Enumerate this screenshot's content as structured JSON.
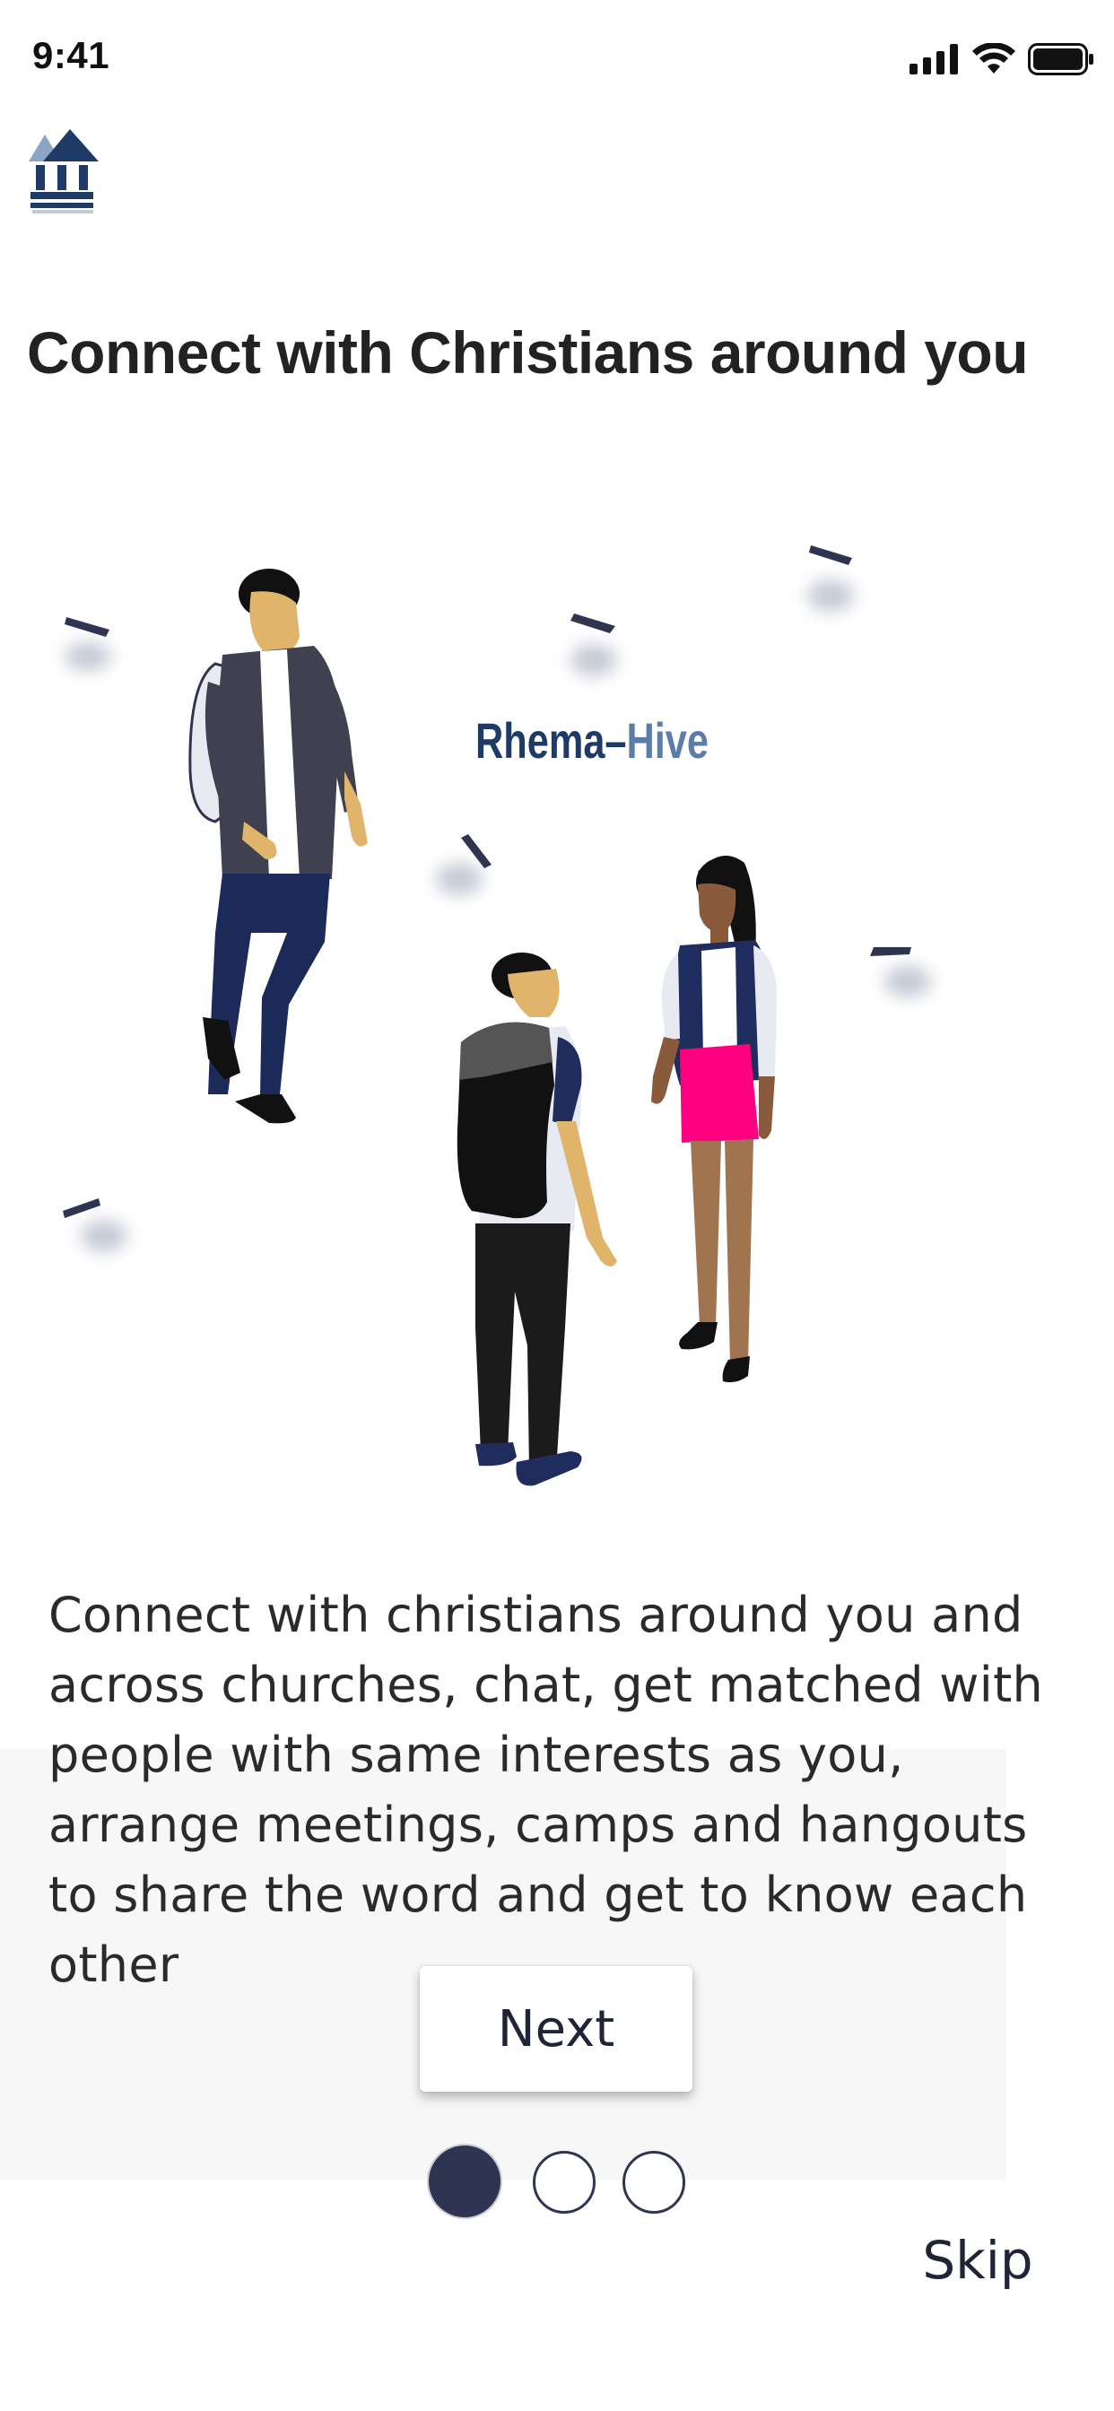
{
  "status_bar": {
    "time": "9:41",
    "icons": [
      "signal-icon",
      "wifi-icon",
      "battery-icon"
    ]
  },
  "logo": {
    "icon": "church-building-icon"
  },
  "headline": "Connect with Christians around you",
  "illustration": {
    "brand_text_left": "Rhema",
    "brand_text_sep": "–",
    "brand_text_right": "Hive"
  },
  "description": "Connect with christians around you and across churches, chat, get matched with people with same interests as you,  arrange meetings, camps and hangouts to share the word and get to know each other",
  "next_label": "Next",
  "pager": {
    "current": 1,
    "total": 3
  },
  "skip_label": "Skip",
  "colors": {
    "accent_navy": "#2f3550",
    "skirt_pink": "#ff0080",
    "panel_bg": "#f7f7f7"
  }
}
